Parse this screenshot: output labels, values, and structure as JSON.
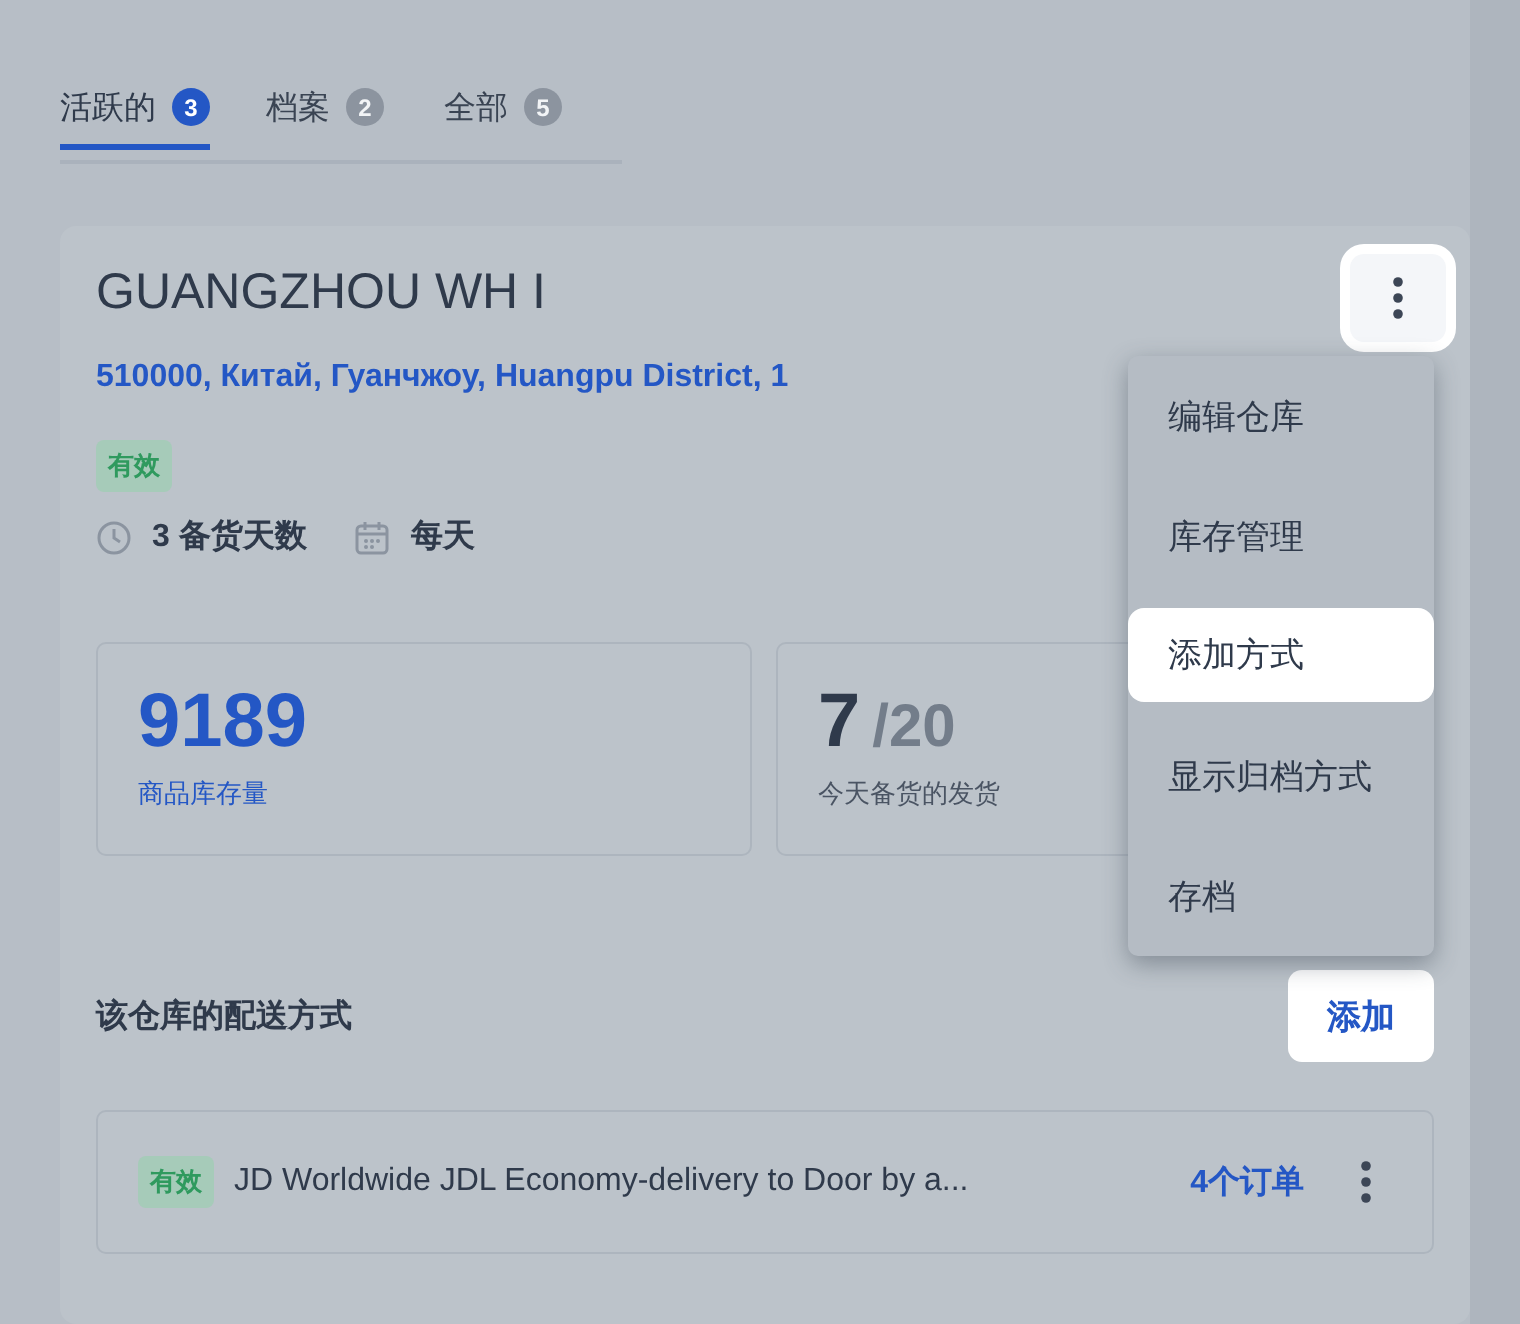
{
  "tabs": [
    {
      "label": "活跃的",
      "count": "3",
      "selected": true
    },
    {
      "label": "档案",
      "count": "2",
      "selected": false
    },
    {
      "label": "全部",
      "count": "5",
      "selected": false
    }
  ],
  "warehouse": {
    "title": "GUANGZHOU WH I",
    "address": "510000, Китай, Гуанчжоу, Huangpu District, 1",
    "status": "有效",
    "prep_days": "3 备货天数",
    "schedule": "每天",
    "menu_button": {
      "highlighted": true
    },
    "stats": [
      {
        "value": "9189",
        "label": "商品库存量",
        "kind": "single"
      },
      {
        "value": "7",
        "total": "/20",
        "label": "今天备货的发货",
        "kind": "ratio"
      }
    ],
    "menu": [
      {
        "label": "编辑仓库",
        "selected": false
      },
      {
        "label": "库存管理",
        "selected": false
      },
      {
        "label": "添加方式",
        "selected": true
      },
      {
        "label": "显示归档方式",
        "selected": false
      },
      {
        "label": "存档",
        "selected": false
      }
    ],
    "shipping": {
      "heading": "该仓库的配送方式",
      "add_button": {
        "label": "添加",
        "highlighted": true
      },
      "methods": [
        {
          "status": "有效",
          "name": "JD Worldwide JDL Economy-delivery to Door by a...",
          "orders": "4个订单"
        }
      ]
    }
  }
}
